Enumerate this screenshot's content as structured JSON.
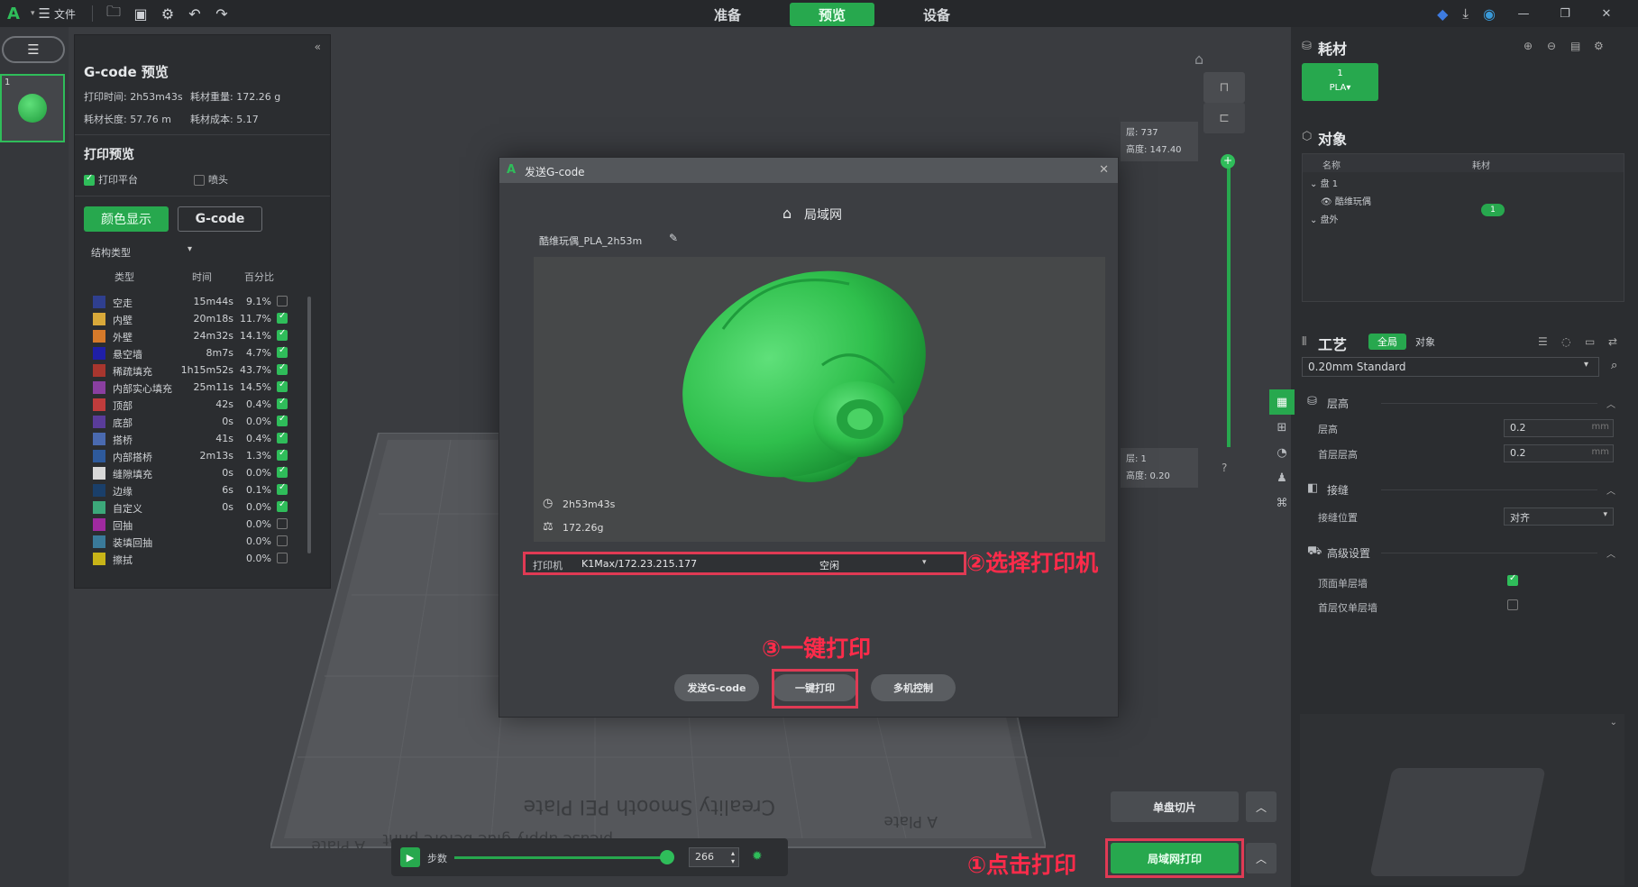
{
  "topbar": {
    "file_label": "文件",
    "tabs": [
      "准备",
      "预览",
      "设备"
    ],
    "active_tab": "预览",
    "icons": [
      "logo-icon",
      "menu-icon",
      "open-folder-icon",
      "save-icon",
      "settings-icon",
      "undo-icon",
      "redo-icon"
    ],
    "window_icons": [
      "minimize-icon",
      "restore-icon",
      "close-icon"
    ]
  },
  "left": {
    "plate_number": "1"
  },
  "gcode_panel": {
    "title": "G-code 预览",
    "print_time": "打印时间: 2h53m43s",
    "filament_weight": "耗材重量: 172.26 g",
    "filament_length": "耗材长度: 57.76 m",
    "filament_cost": "耗材成本: 5.17",
    "print_preview_title": "打印预览",
    "show_platform": "打印平台",
    "show_platform_checked": true,
    "show_nozzle": "喷头",
    "show_nozzle_checked": false,
    "btn_color": "颜色显示",
    "btn_gcode": "G-code",
    "struct_type": "结构类型",
    "legend_headers": [
      "类型",
      "时间",
      "百分比"
    ],
    "legend": [
      {
        "name": "空走",
        "time": "15m44s",
        "pct": "9.1%",
        "color": "#2f3f8f",
        "checked": false
      },
      {
        "name": "内壁",
        "time": "20m18s",
        "pct": "11.7%",
        "color": "#d9a93a",
        "checked": true
      },
      {
        "name": "外壁",
        "time": "24m32s",
        "pct": "14.1%",
        "color": "#d67a2a",
        "checked": true
      },
      {
        "name": "悬空墙",
        "time": "8m7s",
        "pct": "4.7%",
        "color": "#1f1fa8",
        "checked": true
      },
      {
        "name": "稀疏填充",
        "time": "1h15m52s",
        "pct": "43.7%",
        "color": "#a8362e",
        "checked": true
      },
      {
        "name": "内部实心填充",
        "time": "25m11s",
        "pct": "14.5%",
        "color": "#8a3fa0",
        "checked": true
      },
      {
        "name": "顶部",
        "time": "42s",
        "pct": "0.4%",
        "color": "#c03c3c",
        "checked": true
      },
      {
        "name": "底部",
        "time": "0s",
        "pct": "0.0%",
        "color": "#5a3c9a",
        "checked": true
      },
      {
        "name": "搭桥",
        "time": "41s",
        "pct": "0.4%",
        "color": "#4a6ab0",
        "checked": true
      },
      {
        "name": "内部搭桥",
        "time": "2m13s",
        "pct": "1.3%",
        "color": "#2e5a9c",
        "checked": true
      },
      {
        "name": "缝隙填充",
        "time": "0s",
        "pct": "0.0%",
        "color": "#d8d8d8",
        "checked": true
      },
      {
        "name": "边缘",
        "time": "6s",
        "pct": "0.1%",
        "color": "#1a3f6a",
        "checked": true
      },
      {
        "name": "自定义",
        "time": "0s",
        "pct": "0.0%",
        "color": "#3ca87a",
        "checked": true
      },
      {
        "name": "回抽",
        "time": "",
        "pct": "0.0%",
        "color": "#a02aa0",
        "checked": false
      },
      {
        "name": "装填回抽",
        "time": "",
        "pct": "0.0%",
        "color": "#3a7a9a",
        "checked": false
      },
      {
        "name": "擦拭",
        "time": "",
        "pct": "0.0%",
        "color": "#c8b418",
        "checked": false
      }
    ]
  },
  "viewport": {
    "layer_top": "层: 737",
    "height_top": "高度: 147.40",
    "layer_bottom": "层: 1",
    "height_bottom": "高度: 0.20",
    "bed_text_1": "Creality Smooth PEI Plate",
    "bed_text_2": "please apply glue before print",
    "bed_label_a": "A Plate",
    "step_label": "步数",
    "step_value": "266",
    "step_fraction": 0.95
  },
  "bottom_buttons": {
    "single_slice": "单盘切片",
    "lan_print": "局域网打印"
  },
  "annotations": {
    "a1": "①点击打印",
    "a2": "②选择打印机",
    "a3": "③一键打印"
  },
  "right_panel": {
    "filament_title": "耗材",
    "filament_chip_num": "1",
    "filament_chip_type": "PLA▾",
    "objects_title": "对象",
    "obj_headers": [
      "名称",
      "耗材"
    ],
    "plate_label": "盘 1",
    "object_name": "酷维玩偶",
    "object_filament": "1",
    "outside_label": "盘外",
    "process_title": "工艺",
    "process_tabs": [
      "全局",
      "对象"
    ],
    "preset": "0.20mm Standard",
    "sections": {
      "layer_height": "层高",
      "seam": "接缝",
      "advanced": "高级设置"
    },
    "props": {
      "layer_height_label": "层高",
      "layer_height_value": "0.2",
      "first_layer_label": "首层层高",
      "first_layer_value": "0.2",
      "unit": "mm",
      "seam_position_label": "接缝位置",
      "seam_position_value": "对齐",
      "top_one_wall_label": "顶面单层墙",
      "top_one_wall_checked": true,
      "first_one_wall_label": "首层仅单层墙",
      "first_one_wall_checked": false
    }
  },
  "dialog": {
    "title": "发送G-code",
    "lan_label": "局域网",
    "file_name": "酷维玩偶_PLA_2h53m",
    "print_time": "2h53m43s",
    "weight": "172.26g",
    "printer_label": "打印机",
    "printer_value": "K1Max/172.23.215.177",
    "printer_status": "空闲",
    "btn_send": "发送G-code",
    "btn_one_click": "一键打印",
    "btn_multi": "多机控制"
  }
}
